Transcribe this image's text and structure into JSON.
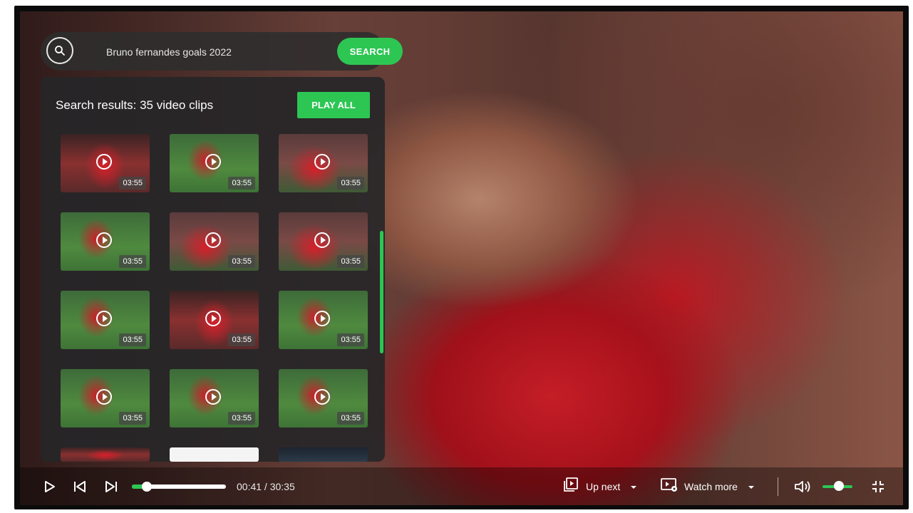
{
  "search": {
    "value": "Bruno fernandes goals 2022",
    "button_label": "SEARCH"
  },
  "results": {
    "title": "Search results: 35 video clips",
    "play_all_label": "PLAY ALL",
    "clips": [
      {
        "duration": "03:55"
      },
      {
        "duration": "03:55"
      },
      {
        "duration": "03:55"
      },
      {
        "duration": "03:55"
      },
      {
        "duration": "03:55"
      },
      {
        "duration": "03:55"
      },
      {
        "duration": "03:55"
      },
      {
        "duration": "03:55"
      },
      {
        "duration": "03:55"
      },
      {
        "duration": "03:55"
      },
      {
        "duration": "03:55"
      },
      {
        "duration": "03:55"
      }
    ]
  },
  "player": {
    "time": "00:41 / 30:35",
    "progress_fraction": 0.022,
    "volume_fraction": 0.55,
    "up_next_label": "Up next",
    "watch_more_label": "Watch more"
  },
  "colors": {
    "accent": "#2dc653",
    "panel": "#262628",
    "text": "#ffffff"
  },
  "icons": [
    "search-icon",
    "play-icon",
    "skip-previous-icon",
    "skip-next-icon",
    "playlist-icon",
    "chevron-down-icon",
    "watch-more-icon",
    "volume-icon",
    "exit-fullscreen-icon"
  ]
}
